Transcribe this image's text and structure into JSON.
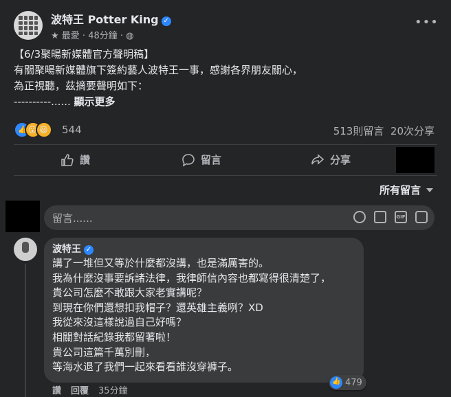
{
  "post": {
    "author": "波特王 Potter King",
    "meta": "最愛 · 48分鐘 ·",
    "lines": [
      "【6/3聚暘新媒體官方聲明稿】",
      "有關聚暘新媒體旗下簽約藝人波特王一事，感謝各界朋友關心，",
      "為正視聽，茲摘要聲明如下：",
      "----------......"
    ],
    "show_more": "顯示更多"
  },
  "reactions": {
    "count": "544",
    "comments": "513則留言",
    "shares": "20次分享"
  },
  "actions": {
    "like": "讚",
    "comment": "留言",
    "share": "分享"
  },
  "sort": {
    "label": "所有留言"
  },
  "composer": {
    "placeholder": "留言......"
  },
  "comment": {
    "author": "波特王",
    "text": "講了一堆但又等於什麼都沒講，也是滿厲害的。\n我為什麼沒事要訴諸法律，我律師信內容也都寫得很清楚了，\n貴公司怎麼不敢跟大家老實講呢？\n到現在你們還想扣我帽子？還英雄主義咧？XD\n我從來沒這樣說過自己好嗎？\n相關對話紀錄我都留著啦！\n貴公司這篇千萬別刪，\n等海水退了我們一起來看看誰沒穿褲子。",
    "likes": "479",
    "like_label": "讚",
    "reply_label": "回覆",
    "time": "35分鐘"
  },
  "colors": {
    "background": "#242526",
    "bubble": "#3a3b3c",
    "accent": "#2d88ff",
    "text": "#e4e6eb",
    "secondary": "#b0b3b8"
  },
  "icons": [
    "verified-icon",
    "star-icon",
    "globe-icon",
    "more-icon",
    "like-icon",
    "comment-icon",
    "share-icon",
    "emoji-icon",
    "camera-icon",
    "gif-icon",
    "sticker-icon"
  ]
}
